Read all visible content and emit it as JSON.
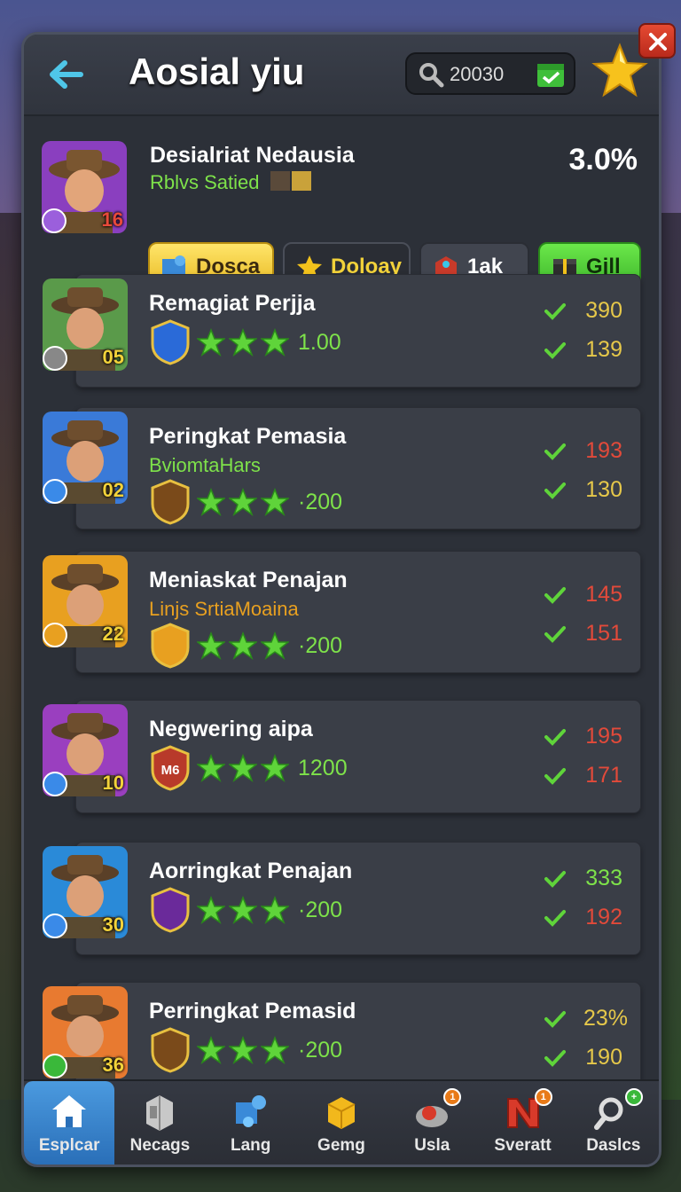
{
  "header": {
    "title": "Aosial yiu",
    "search_value": "20030"
  },
  "feature": {
    "name": "Desialriat Nedausia",
    "subtitle": "Rblvs Satied",
    "percent": "3.0%",
    "level": "16",
    "buttons": [
      {
        "label": "Dosca"
      },
      {
        "label": "Doloay"
      },
      {
        "label": "1ak"
      },
      {
        "label": "Gjll"
      }
    ]
  },
  "rows": [
    {
      "name": "Remagiat Perjja",
      "subtitle": "",
      "score": "1.00",
      "level": "05",
      "stat1": "390",
      "stat2": "139",
      "stat1_color": "#e6c84a",
      "stat2_color": "#e6c84a"
    },
    {
      "name": "Peringkat Pemasia",
      "subtitle": "BviomtaHars",
      "score": "·200",
      "level": "02",
      "stat1": "193",
      "stat2": "130",
      "stat1_color": "#e24a3a",
      "stat2_color": "#e6c84a"
    },
    {
      "name": "Meniaskat Penajan",
      "subtitle": "Linjs SrtiaMoaina",
      "score": "·200",
      "level": "22",
      "stat1": "145",
      "stat2": "151",
      "stat1_color": "#e24a3a",
      "stat2_color": "#e24a3a"
    },
    {
      "name": "Negwering aipa",
      "subtitle": "",
      "score": "1200",
      "emblem_text": "M6",
      "level": "10",
      "stat1": "195",
      "stat2": "171",
      "stat1_color": "#e24a3a",
      "stat2_color": "#e24a3a"
    },
    {
      "name": "Aorringkat Penajan",
      "subtitle": "",
      "score": "·200",
      "level": "30",
      "stat1": "333",
      "stat2": "192",
      "stat1_color": "#7ee24a",
      "stat2_color": "#e24a3a"
    },
    {
      "name": "Perringkat Pemasid",
      "subtitle": "",
      "score": "·200",
      "level": "36",
      "stat1": "23%",
      "stat2": "190",
      "stat1_color": "#e6c84a",
      "stat2_color": "#e6c84a"
    }
  ],
  "nav": [
    {
      "label": "Esplcar",
      "icon": "home-icon",
      "active": true
    },
    {
      "label": "Necags",
      "icon": "box-icon"
    },
    {
      "label": "Lang",
      "icon": "pieces-icon"
    },
    {
      "label": "Gemg",
      "icon": "gold-cube-icon"
    },
    {
      "label": "Usla",
      "icon": "chest-icon",
      "badge": "1"
    },
    {
      "label": "Sveratt",
      "icon": "n-icon",
      "badge": "1"
    },
    {
      "label": "Daslcs",
      "icon": "magnifier-icon",
      "badge": "+"
    }
  ],
  "colors": {
    "accent_green": "#7ee24a",
    "accent_yellow": "#f2d23a",
    "stat_red": "#e24a3a",
    "stat_yellow": "#e6c84a",
    "nav_active": "#2a6fb8"
  }
}
